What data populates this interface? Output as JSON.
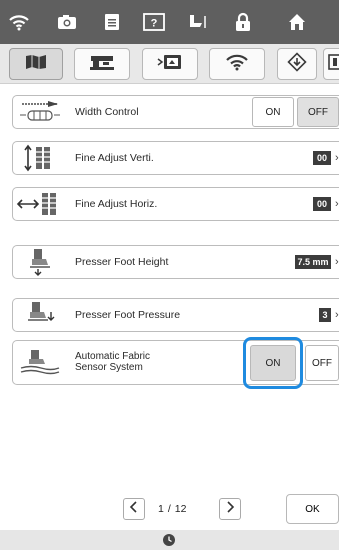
{
  "toolbar": {
    "icons": [
      "wifi-icon",
      "camera-icon",
      "document-icon",
      "help-icon",
      "needle-icon",
      "lock-icon",
      "home-icon"
    ]
  },
  "tabs": {
    "icons": [
      "sewing-settings-icon",
      "machine-settings-icon",
      "display-settings-icon",
      "wireless-icon",
      "update-icon",
      "info-icon"
    ],
    "active_index": 0
  },
  "settings": {
    "width_control": {
      "label": "Width Control",
      "on": "ON",
      "off": "OFF",
      "selected": "OFF"
    },
    "fine_adjust_verti": {
      "label": "Fine Adjust Verti.",
      "value": "00"
    },
    "fine_adjust_horiz": {
      "label": "Fine Adjust Horiz.",
      "value": "00"
    },
    "presser_foot_height": {
      "label": "Presser Foot Height",
      "value": "7.5 mm"
    },
    "presser_foot_pressure": {
      "label": "Presser Foot Pressure",
      "value": "3"
    },
    "auto_fabric_sensor": {
      "label_line1": "Automatic Fabric",
      "label_line2": "Sensor System",
      "on": "ON",
      "off": "OFF",
      "selected": "ON"
    }
  },
  "pager": {
    "current": "1",
    "separator": "/",
    "total": "12"
  },
  "ok_label": "OK",
  "colors": {
    "toolbar": "#5f5f5f",
    "highlight": "#1f8be0",
    "value_box": "#3c3c3c"
  }
}
